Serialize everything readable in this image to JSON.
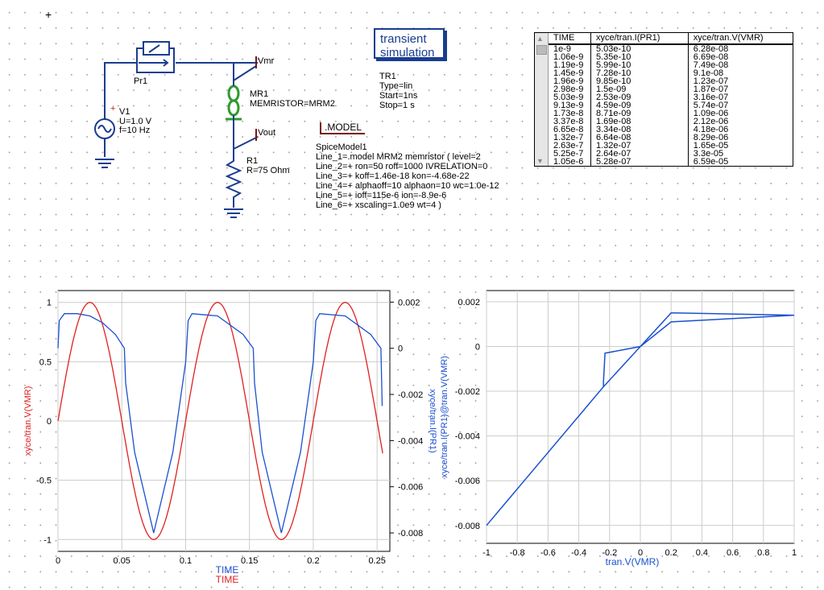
{
  "schematic": {
    "probe_label": "Pr1",
    "source": {
      "name": "V1",
      "voltage": "U=1.0 V",
      "freq": "f=10 Hz",
      "plus": "+"
    },
    "memristor": {
      "name": "MR1",
      "model": "MEMRISTOR=MRM2"
    },
    "resistor": {
      "name": "R1",
      "value": "R=75 Ohm"
    },
    "nodes": {
      "vmr": "Vmr",
      "vout": "Vout"
    }
  },
  "simulation": {
    "box_line1": "transient",
    "box_line2": "simulation",
    "name": "TR1",
    "type": "Type=lin",
    "start": "Start=1ns",
    "stop": "Stop=1 s"
  },
  "model": {
    "label": ".MODEL",
    "name": "SpiceModel1",
    "lines": [
      "Line_1=.model MRM2 memristor ( level=2",
      "Line_2=+ ron=50 roff=1000 IVRELATION=0",
      "Line_3=+ koff=1.46e-18 kon=-4.68e-22",
      "Line_4=+ alphaoff=10 alphaon=10 wc=1.0e-12",
      "Line_5=+ ioff=115e-6 ion=-8.9e-6",
      "Line_6=+ xscaling=1.0e9 wt=4 )"
    ]
  },
  "table": {
    "headers": [
      "TIME",
      "xyce/tran.I(PR1)",
      "xyce/tran.V(VMR)"
    ],
    "rows": [
      [
        "1e-9",
        "5.03e-10",
        "6.28e-08"
      ],
      [
        "1.06e-9",
        "5.35e-10",
        "6.69e-08"
      ],
      [
        "1.19e-9",
        "5.99e-10",
        "7.49e-08"
      ],
      [
        "1.45e-9",
        "7.28e-10",
        "9.1e-08"
      ],
      [
        "1.96e-9",
        "9.85e-10",
        "1.23e-07"
      ],
      [
        "2.98e-9",
        "1.5e-09",
        "1.87e-07"
      ],
      [
        "5.03e-9",
        "2.53e-09",
        "3.16e-07"
      ],
      [
        "9.13e-9",
        "4.59e-09",
        "5.74e-07"
      ],
      [
        "1.73e-8",
        "8.71e-09",
        "1.09e-06"
      ],
      [
        "3.37e-8",
        "1.69e-08",
        "2.12e-06"
      ],
      [
        "6.65e-8",
        "3.34e-08",
        "4.18e-06"
      ],
      [
        "1.32e-7",
        "6.64e-08",
        "8.29e-06"
      ],
      [
        "2.63e-7",
        "1.32e-07",
        "1.65e-05"
      ],
      [
        "5.25e-7",
        "2.64e-07",
        "3.3e-05"
      ],
      [
        "1.05e-6",
        "5.28e-07",
        "6.59e-05"
      ]
    ]
  },
  "colors": {
    "wire": "#1a3d8f",
    "voltage": "#e02020",
    "current": "#1a50d0",
    "inductor": "#2e9a2e"
  },
  "chart_data": [
    {
      "type": "line",
      "xlabel": "TIME",
      "xlabel2": "TIME",
      "ylabel_left": "xyce/tran.V(VMR)",
      "ylabel_right": "xyce/tran.I(PR1)",
      "xlim": [
        0,
        0.26
      ],
      "ylim_left": [
        -1.1,
        1.1
      ],
      "ylim_right": [
        -0.0088,
        0.0025
      ],
      "xticks": [
        "0",
        "0.05",
        "0.1",
        "0.15",
        "0.2",
        "0.25"
      ],
      "yticks_left": [
        "1",
        "0.5",
        "0",
        "-0.5",
        "-1"
      ],
      "yticks_right": [
        "0.002",
        "0",
        "-0.002",
        "-0.004",
        "-0.006",
        "-0.008"
      ],
      "grid": true,
      "series": [
        {
          "name": "xyce/tran.V(VMR)",
          "axis": "left",
          "color": "#e02020",
          "x": [
            0,
            0.025,
            0.05,
            0.075,
            0.1,
            0.125,
            0.15,
            0.175,
            0.2,
            0.225,
            0.25,
            0.255
          ],
          "y": [
            0,
            1,
            0,
            -1,
            0,
            1,
            0,
            -1,
            0,
            1,
            0,
            -0.3
          ]
        },
        {
          "name": "xyce/tran.I(PR1)",
          "axis": "right",
          "color": "#1a50d0",
          "x": [
            0,
            0.001,
            0.005,
            0.015,
            0.025,
            0.035,
            0.045,
            0.052,
            0.053,
            0.06,
            0.075,
            0.09,
            0.1,
            0.102,
            0.105,
            0.125,
            0.145,
            0.153,
            0.154,
            0.16,
            0.175,
            0.19,
            0.2,
            0.202,
            0.205,
            0.225,
            0.245,
            0.253,
            0.254
          ],
          "y": [
            0.0,
            0.0012,
            0.0015,
            0.0015,
            0.0014,
            0.0011,
            0.0006,
            0.0,
            -0.0015,
            -0.0045,
            -0.008,
            -0.0045,
            -0.0006,
            0.0012,
            0.0015,
            0.0014,
            0.0006,
            0.0,
            -0.0015,
            -0.0045,
            -0.008,
            -0.0045,
            -0.0006,
            0.0012,
            0.0015,
            0.0014,
            0.0006,
            0.0,
            -0.0025
          ]
        }
      ]
    },
    {
      "type": "line",
      "xlabel": "tran.V(VMR)",
      "ylabel": "xyce/tran.I(PR1)@tran.V(VMR)",
      "xlim": [
        -1,
        1
      ],
      "ylim": [
        -0.0088,
        0.0025
      ],
      "xticks": [
        "-1",
        "-0.8",
        "-0.6",
        "-0.4",
        "-0.2",
        "0",
        "0.2",
        "0.4",
        "0.6",
        "0.8",
        "1"
      ],
      "yticks": [
        "0.002",
        "0",
        "-0.002",
        "-0.004",
        "-0.006",
        "-0.008"
      ],
      "grid": true,
      "series": [
        {
          "color": "#1a50d0",
          "x": [
            -1,
            -0.24,
            -0.24,
            -0.23,
            0,
            0.2,
            0.22,
            1,
            0.2,
            0,
            -0.24
          ],
          "y": [
            -0.008,
            -0.0018,
            -0.0016,
            -0.0003,
            0.0,
            0.0015,
            0.0015,
            0.0014,
            0.0011,
            0.0,
            -0.0018
          ]
        }
      ]
    }
  ]
}
